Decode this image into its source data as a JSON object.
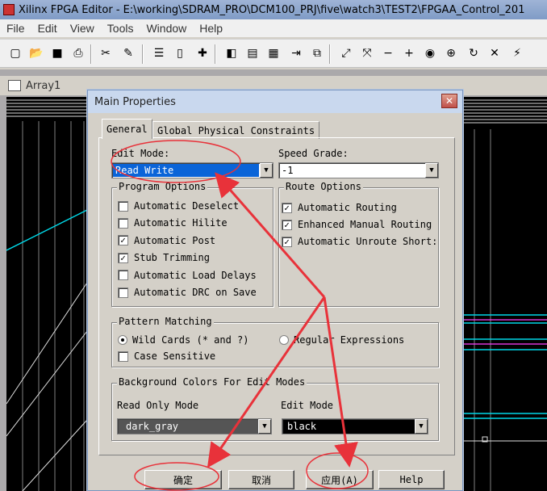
{
  "window": {
    "title": "Xilinx FPGA Editor - E:\\working\\SDRAM_PRO\\DCM100_PRJ\\five\\watch3\\TEST2\\FPGAA_Control_201"
  },
  "menu": [
    "File",
    "Edit",
    "View",
    "Tools",
    "Window",
    "Help"
  ],
  "toolbar": {
    "icons": [
      "new-file-icon",
      "open-folder-icon",
      "save-icon",
      "print-icon",
      "cut-icon",
      "paste-icon",
      "list-icon",
      "component-icon",
      "add-icon",
      "panel-icon",
      "table-icon",
      "grid-icon",
      "route-icon",
      "copy-icon",
      "fit-icon",
      "zoom-select-icon",
      "zoom-out-icon",
      "zoom-in-icon",
      "zoom-fit-icon",
      "zoom-area-icon",
      "refresh-icon",
      "stop-icon",
      "probe-icon"
    ],
    "glyphs": [
      "▢",
      "📂",
      "■",
      "⎙",
      "✂",
      "✎",
      "☰",
      "▯",
      "✚",
      "◧",
      "▤",
      "▦",
      "⇥",
      "⧉",
      "⤢",
      "⤧",
      "−",
      "+",
      "◉",
      "⊕",
      "↻",
      "✕",
      "⚡"
    ]
  },
  "child_window": {
    "title": "Array1"
  },
  "dialog": {
    "title": "Main Properties",
    "close_label": "✕",
    "tabs": [
      "General",
      "Global Physical Constraints"
    ],
    "edit_mode": {
      "label": "Edit Mode:",
      "value": "Read Write"
    },
    "speed_grade": {
      "label": "Speed Grade:",
      "value": "-1"
    },
    "program_options": {
      "title": "Program Options",
      "items": [
        {
          "label": "Automatic Deselect",
          "checked": false
        },
        {
          "label": "Automatic Hilite",
          "checked": false
        },
        {
          "label": "Automatic Post",
          "checked": true
        },
        {
          "label": "Stub Trimming",
          "checked": true
        },
        {
          "label": "Automatic Load Delays",
          "checked": false
        },
        {
          "label": "Automatic DRC on Save",
          "checked": false
        }
      ]
    },
    "route_options": {
      "title": "Route Options",
      "items": [
        {
          "label": "Automatic Routing",
          "checked": true
        },
        {
          "label": "Enhanced Manual Routing",
          "checked": true
        },
        {
          "label": "Automatic Unroute Short:",
          "checked": true
        }
      ]
    },
    "pattern_matching": {
      "title": "Pattern Matching",
      "wild_cards": "Wild Cards (* and ?)",
      "regular_expressions": "Regular Expressions",
      "case_sensitive": "Case Sensitive"
    },
    "background_colors": {
      "title": "Background Colors For Edit Modes",
      "read_only_label": "Read Only Mode",
      "read_only_value": "dark_gray",
      "edit_label": "Edit Mode",
      "edit_value": "black"
    },
    "buttons": {
      "ok": "确定",
      "cancel": "取消",
      "apply": "应用(A)",
      "help": "Help"
    }
  },
  "colors": {
    "annotation": "#e8323a",
    "selection": "#0a64d8",
    "canvas": "#000000",
    "trace": "#00d8e8"
  }
}
